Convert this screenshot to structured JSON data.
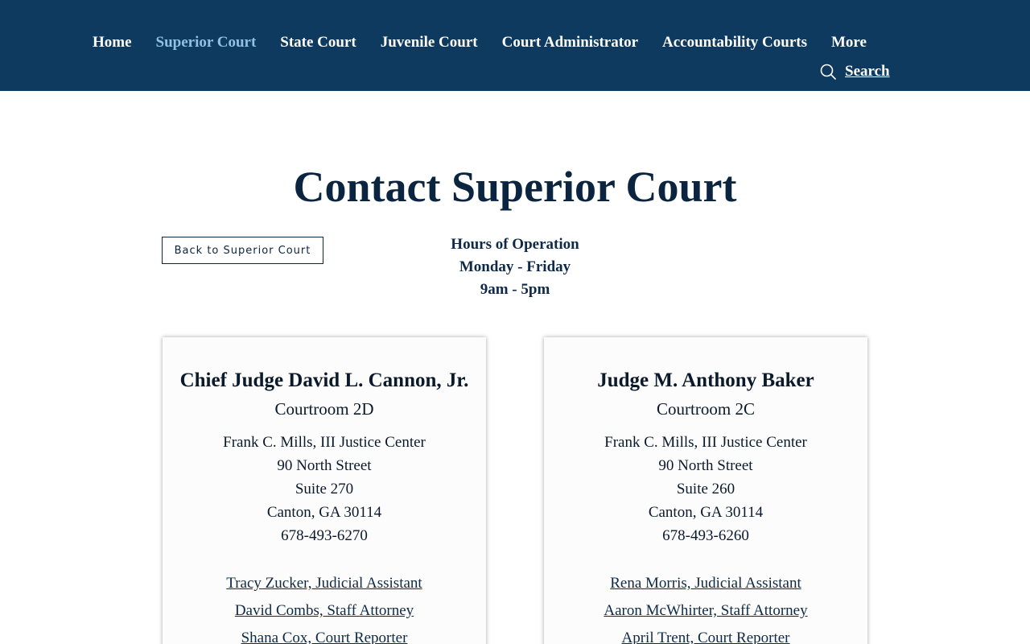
{
  "nav": {
    "items": [
      {
        "label": "Home",
        "active": false
      },
      {
        "label": "Superior Court",
        "active": true
      },
      {
        "label": "State Court",
        "active": false
      },
      {
        "label": "Juvenile Court",
        "active": false
      },
      {
        "label": "Court Administrator",
        "active": false
      },
      {
        "label": "Accountability Courts",
        "active": false
      },
      {
        "label": "More",
        "active": false
      }
    ],
    "search_label": "Search",
    "search_icon": "search-icon"
  },
  "colors": {
    "header_bg": "#0e3a5f",
    "active_nav": "#8fc0e6",
    "title": "#0b2440"
  },
  "page": {
    "title": "Contact Superior Court",
    "back_button": "Back to Superior Court",
    "hours": {
      "heading": "Hours of Operation",
      "days": "Monday - Friday",
      "time": "9am - 5pm"
    }
  },
  "judges": [
    {
      "name": "Chief Judge David L. Cannon, Jr.",
      "courtroom": "Courtroom 2D",
      "address": [
        "Frank C. Mills, III Justice Center",
        "90 North Street",
        "Suite 270",
        "Canton, GA 30114",
        "678-493-6270"
      ],
      "staff": [
        "Tracy Zucker, Judicial Assistant",
        "David Combs, Staff Attorney",
        "Shana Cox, Court Reporter"
      ]
    },
    {
      "name": "Judge M. Anthony Baker",
      "courtroom": "Courtroom 2C",
      "address": [
        "Frank C. Mills, III Justice Center",
        "90 North Street",
        "Suite 260",
        "Canton, GA 30114",
        "678-493-6260"
      ],
      "staff": [
        "Rena Morris, Judicial Assistant",
        "Aaron McWhirter, Staff Attorney",
        "April Trent, Court Reporter"
      ]
    }
  ]
}
